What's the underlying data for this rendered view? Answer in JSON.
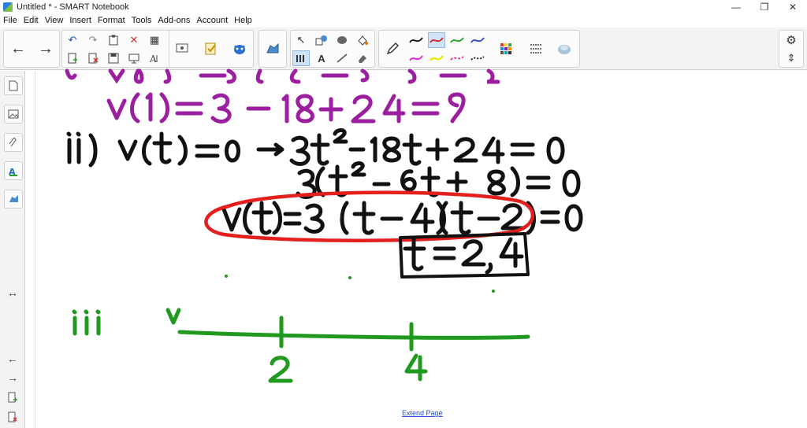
{
  "window": {
    "title": "Untitled * - SMART Notebook",
    "controls": {
      "minimize": "—",
      "restore": "❐",
      "close": "✕"
    }
  },
  "menu": [
    "File",
    "Edit",
    "View",
    "Insert",
    "Format",
    "Tools",
    "Add-ons",
    "Account",
    "Help"
  ],
  "toolbar": {
    "nav": {
      "back": "←",
      "forward": "→"
    },
    "edit": {
      "undo": "↶",
      "redo": "↷",
      "delete": "✕",
      "table": "▦"
    },
    "select": "↖",
    "text_tool": "A",
    "pen_colors": [
      "#111111",
      "#d62020",
      "#1fa31f",
      "#2c3fd6",
      "#e21ad8",
      "#e8e800",
      "#ea2a9a",
      "#111111"
    ],
    "settings": "⚙",
    "updown": "⇕"
  },
  "sidebar": {
    "resize": "↔",
    "back": "←",
    "forward": "→"
  },
  "canvas": {
    "extend_page": "Extend Page",
    "ink_colors": {
      "purple": "#9b1f9e",
      "black": "#111111",
      "red": "#e3201e",
      "green": "#1f9a1f"
    }
  }
}
